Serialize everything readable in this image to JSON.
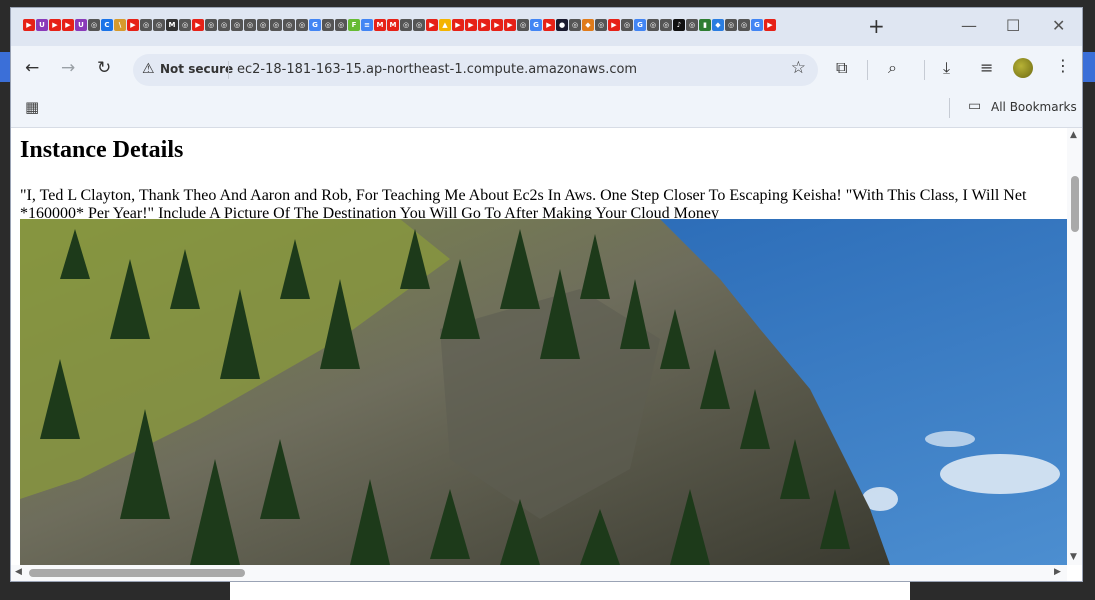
{
  "browser": {
    "tab_favicons": [
      {
        "icon": "youtube-icon",
        "color": "#e62117",
        "glyph": "▶"
      },
      {
        "icon": "uscis-icon",
        "color": "#8a3ab9",
        "glyph": "U"
      },
      {
        "icon": "youtube-icon",
        "color": "#e62117",
        "glyph": "▶"
      },
      {
        "icon": "youtube-icon",
        "color": "#e62117",
        "glyph": "▶"
      },
      {
        "icon": "uscis-icon",
        "color": "#8a3ab9",
        "glyph": "U"
      },
      {
        "icon": "openai-icon",
        "color": "#555555",
        "glyph": "◎"
      },
      {
        "icon": "c-icon",
        "color": "#1a73e8",
        "glyph": "C"
      },
      {
        "icon": "stripe-icon",
        "color": "#d69a2d",
        "glyph": "\\"
      },
      {
        "icon": "youtube-icon",
        "color": "#e62117",
        "glyph": "▶"
      },
      {
        "icon": "openai-icon",
        "color": "#555555",
        "glyph": "◎"
      },
      {
        "icon": "openai-icon",
        "color": "#555555",
        "glyph": "◎"
      },
      {
        "icon": "m-icon",
        "color": "#333333",
        "glyph": "M"
      },
      {
        "icon": "openai-icon",
        "color": "#555555",
        "glyph": "◎"
      },
      {
        "icon": "youtube-icon",
        "color": "#e62117",
        "glyph": "▶"
      },
      {
        "icon": "openai-icon",
        "color": "#555555",
        "glyph": "◎"
      },
      {
        "icon": "openai-icon",
        "color": "#555555",
        "glyph": "◎"
      },
      {
        "icon": "openai-icon",
        "color": "#555555",
        "glyph": "◎"
      },
      {
        "icon": "openai-icon",
        "color": "#555555",
        "glyph": "◎"
      },
      {
        "icon": "openai-icon",
        "color": "#555555",
        "glyph": "◎"
      },
      {
        "icon": "openai-icon",
        "color": "#555555",
        "glyph": "◎"
      },
      {
        "icon": "openai-icon",
        "color": "#555555",
        "glyph": "◎"
      },
      {
        "icon": "openai-icon",
        "color": "#555555",
        "glyph": "◎"
      },
      {
        "icon": "google-icon",
        "color": "#4285f4",
        "glyph": "G"
      },
      {
        "icon": "openai-icon",
        "color": "#555555",
        "glyph": "◎"
      },
      {
        "icon": "openai-icon",
        "color": "#555555",
        "glyph": "◎"
      },
      {
        "icon": "f-icon",
        "color": "#66bb33",
        "glyph": "F"
      },
      {
        "icon": "forms-icon",
        "color": "#4285f4",
        "glyph": "≡"
      },
      {
        "icon": "gmail-icon",
        "color": "#e62117",
        "glyph": "M"
      },
      {
        "icon": "gmail-icon",
        "color": "#e62117",
        "glyph": "M"
      },
      {
        "icon": "openai-icon",
        "color": "#555555",
        "glyph": "◎"
      },
      {
        "icon": "openai-icon",
        "color": "#555555",
        "glyph": "◎"
      },
      {
        "icon": "youtube-icon",
        "color": "#e62117",
        "glyph": "▶"
      },
      {
        "icon": "drive-icon",
        "color": "#f4b400",
        "glyph": "▲"
      },
      {
        "icon": "youtube-icon",
        "color": "#e62117",
        "glyph": "▶"
      },
      {
        "icon": "youtube-icon",
        "color": "#e62117",
        "glyph": "▶"
      },
      {
        "icon": "youtube-icon",
        "color": "#e62117",
        "glyph": "▶"
      },
      {
        "icon": "youtube-icon",
        "color": "#e62117",
        "glyph": "▶"
      },
      {
        "icon": "youtube-icon",
        "color": "#e62117",
        "glyph": "▶"
      },
      {
        "icon": "openai-icon",
        "color": "#555555",
        "glyph": "◎"
      },
      {
        "icon": "google-icon",
        "color": "#4285f4",
        "glyph": "G"
      },
      {
        "icon": "youtube-icon",
        "color": "#e62117",
        "glyph": "▶"
      },
      {
        "icon": "dark-circle-icon",
        "color": "#1a1a2e",
        "glyph": "●"
      },
      {
        "icon": "openai-icon",
        "color": "#555555",
        "glyph": "◎"
      },
      {
        "icon": "shield-icon",
        "color": "#e07b1a",
        "glyph": "◆"
      },
      {
        "icon": "openai-icon",
        "color": "#555555",
        "glyph": "◎"
      },
      {
        "icon": "youtube-icon",
        "color": "#e62117",
        "glyph": "▶"
      },
      {
        "icon": "openai-icon",
        "color": "#555555",
        "glyph": "◎"
      },
      {
        "icon": "google-icon",
        "color": "#4285f4",
        "glyph": "G"
      },
      {
        "icon": "openai-icon",
        "color": "#555555",
        "glyph": "◎"
      },
      {
        "icon": "openai-icon",
        "color": "#555555",
        "glyph": "◎"
      },
      {
        "icon": "tiktok-icon",
        "color": "#111111",
        "glyph": "♪"
      },
      {
        "icon": "openai-icon",
        "color": "#555555",
        "glyph": "◎"
      },
      {
        "icon": "bookmark-green-icon",
        "color": "#2e7d32",
        "glyph": "▮"
      },
      {
        "icon": "diamond-icon",
        "color": "#2a7de1",
        "glyph": "◆"
      },
      {
        "icon": "openai-icon",
        "color": "#555555",
        "glyph": "◎"
      },
      {
        "icon": "openai-icon",
        "color": "#555555",
        "glyph": "◎"
      },
      {
        "icon": "google-icon",
        "color": "#4285f4",
        "glyph": "G"
      },
      {
        "icon": "youtube-icon",
        "color": "#e62117",
        "glyph": "▶"
      }
    ],
    "new_tab_glyph": "+",
    "window_controls": {
      "minimize": "—",
      "maximize": "☐",
      "close": "✕"
    },
    "nav": {
      "back": "←",
      "forward": "→",
      "reload": "↻"
    },
    "security_icon": "⚠",
    "security_label": "Not secure",
    "url": "ec2-18-181-163-15.ap-northeast-1.compute.amazonaws.com",
    "star_icon": "☆",
    "extensions_icon": "⧉",
    "search_tabs_icon": "⌕",
    "download_icon": "⤓",
    "media_icon": "≡",
    "menu_icon": "⋮",
    "apps_icon": "▦",
    "bookmarks_folder_icon": "▭",
    "bookmarks_label": "All Bookmarks"
  },
  "page": {
    "heading": "Instance Details",
    "paragraph": "\"I, Ted L Clayton, Thank Theo And Aaron and Rob, For Teaching Me About Ec2s In Aws. One Step Closer To Escaping Keisha! \"With This Class, I Will Net *160000* Per Year!\" Include A Picture Of The Destination You Will Go To After Making Your Cloud Money"
  },
  "scrollbar": {
    "up": "▲",
    "down": "▼",
    "left": "◀",
    "right": "▶"
  },
  "colors": {
    "sky": "#3f7fc2",
    "cliff": "#6b6b5a",
    "grass": "#8a9a3c",
    "trees": "#1f3a1c"
  }
}
